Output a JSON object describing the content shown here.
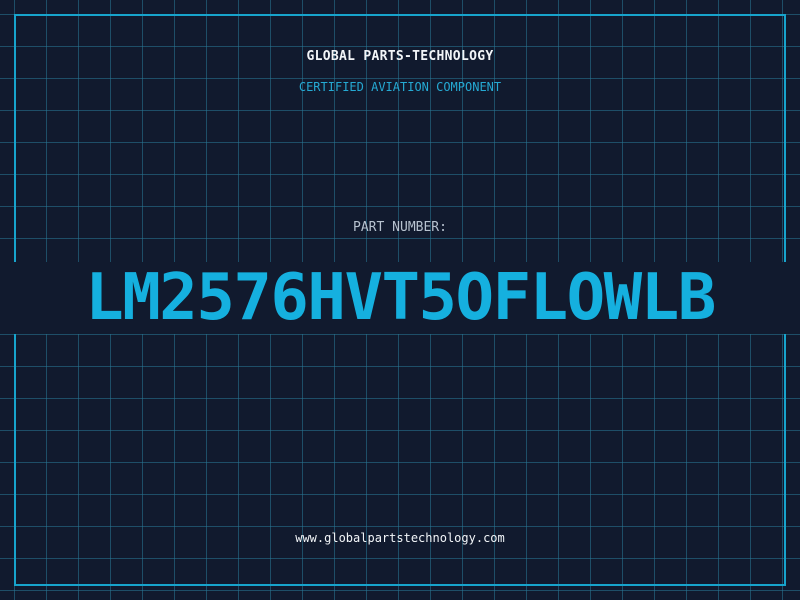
{
  "header": {
    "brand": "GLOBAL PARTS-TECHNOLOGY",
    "subtitle": "CERTIFIED AVIATION COMPONENT"
  },
  "part": {
    "label": "PART NUMBER:",
    "number": "LM2576HVT5OFLOWLB"
  },
  "footer": {
    "website": "www.globalpartstechnology.com"
  },
  "colors": {
    "background": "#111a2e",
    "grid": "#28788f",
    "accent": "#15b0df",
    "text": "#f2f5f8"
  }
}
